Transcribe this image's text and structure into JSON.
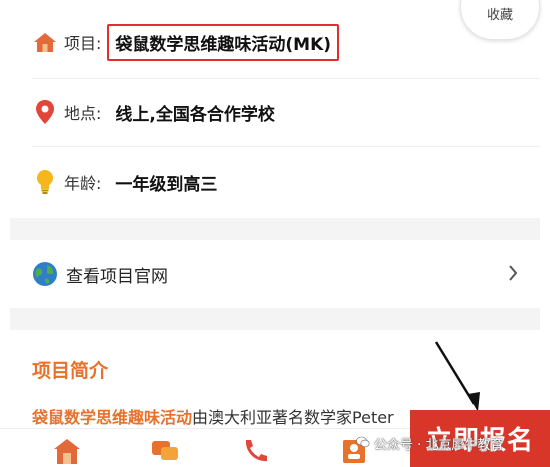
{
  "info": {
    "favorite_label": "收藏",
    "project": {
      "label": "项目:",
      "value": "袋鼠数学思维趣味活动(MK)",
      "icon": "home-icon"
    },
    "location": {
      "label": "地点:",
      "value": "线上,全国各合作学校",
      "icon": "location-pin-icon"
    },
    "age": {
      "label": "年龄:",
      "value": "一年级到高三",
      "icon": "lightbulb-icon"
    }
  },
  "website": {
    "label": "查看项目官网",
    "icon": "globe-icon"
  },
  "intro": {
    "title": "项目简介",
    "highlight": "袋鼠数学思维趣味活动",
    "text": "由澳大利亚著名数学家Peter"
  },
  "bottom_bar": {
    "signup_label": "立即报名",
    "watermark": "公众号 · 北京犀牛教育",
    "icons": [
      "home-icon",
      "chat-icon",
      "phone-icon",
      "profile-icon"
    ]
  },
  "colors": {
    "accent": "#e8712b",
    "highlight_border": "#e0302c",
    "signup_bg": "#d9362a",
    "gap_bg": "#f4f4f4"
  }
}
